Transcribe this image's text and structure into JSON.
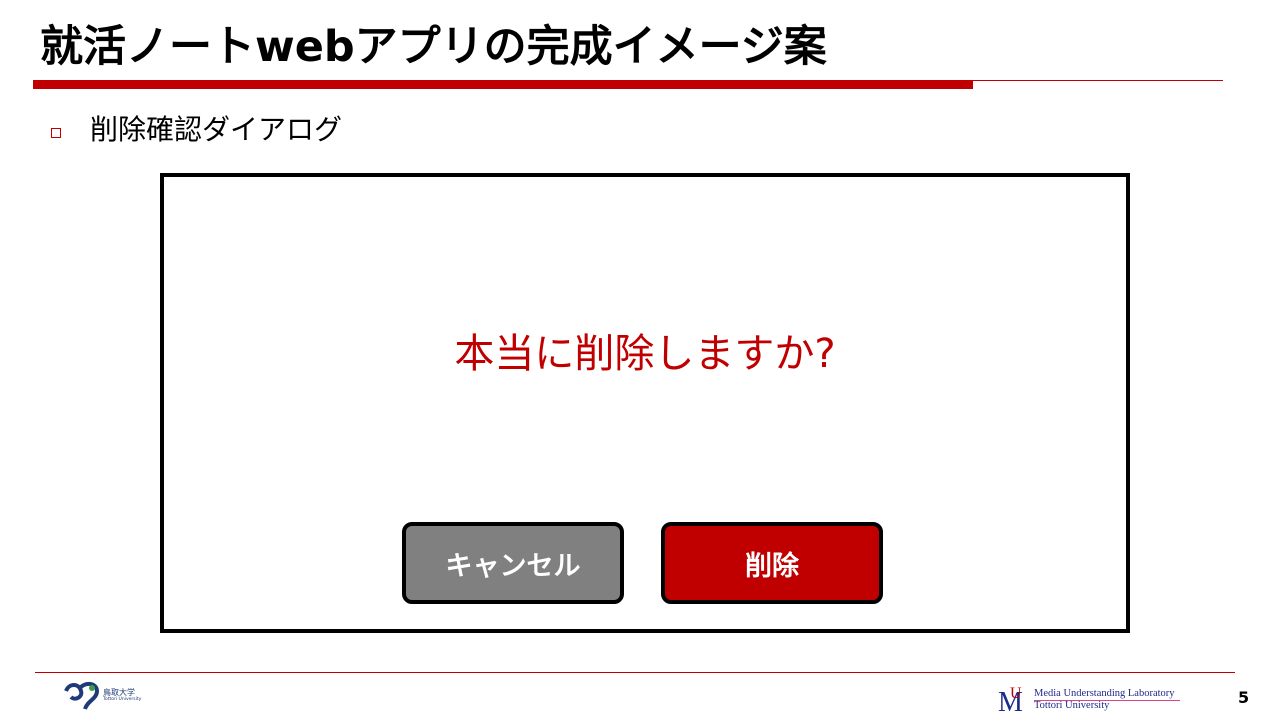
{
  "slide": {
    "title": "就活ノートwebアプリの完成イメージ案",
    "subtitle": "削除確認ダイアログ",
    "page_number": "5"
  },
  "dialog": {
    "message": "本当に削除しますか?",
    "cancel_label": "キャンセル",
    "delete_label": "削除"
  },
  "footer": {
    "university_logo_jp": "鳥取大学",
    "university_logo_en": "Tottori University",
    "lab_logo_line1": "Media Understanding Laboratory",
    "lab_logo_line2": "Tottori University"
  },
  "colors": {
    "accent": "#c00000",
    "cancel_button": "#808080",
    "delete_button": "#c00000"
  }
}
